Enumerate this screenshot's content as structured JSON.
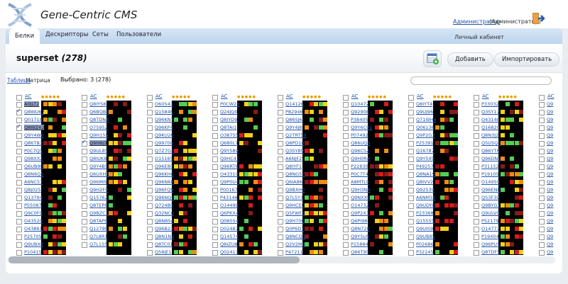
{
  "app": {
    "title": "Gene-Centric CMS",
    "user_link": "Администратор",
    "user_role": "(Администратор)"
  },
  "tabs": [
    "Белки",
    "Дескрипторы",
    "Сеты",
    "Пользователи"
  ],
  "cabinet_label": "Личный кабинет",
  "set": {
    "name": "superset",
    "count": "(278)"
  },
  "buttons": {
    "add": "Добавить",
    "import": "Импортировать"
  },
  "view": {
    "table_link": "Таблица",
    "current": "Матрица",
    "selected": "Выбрано: 3 (278)"
  },
  "grid_header": "AC",
  "colors": {
    "green": "#55cc55",
    "yellow": "#f2d21a",
    "orange": "#f08c10",
    "red": "#d81b1b",
    "darkred": "#8a1a1a",
    "highlight": "#8aa0c4"
  },
  "groups": [
    [
      "A0JLT2",
      "Q8WU67",
      "Q01718",
      "Q8WZ42",
      "Q9Y4W6",
      "Q86TB3",
      "P0C7Q5",
      "Q98XX2",
      "Q6UB98",
      "Q8N6Q5",
      "A6NC57",
      "Q8J025",
      "Q13794",
      "P55087",
      "Q9C0F0",
      "O43520",
      "O43861",
      "P25705",
      "Q9UBX8",
      "P10415"
    ],
    [
      "Q8IYS8",
      "Q6BQB6",
      "Q8TDN4",
      "O75952",
      "Q9H159",
      "Q9H8J3",
      "Q9UL85",
      "Q8IUK8",
      "Q9Y4B5",
      "Q6UXH8",
      "Q96MI9",
      "Q9H2F9",
      "Q15762",
      "Q8TEP8",
      "Q9BZC1",
      "Q8TAP6",
      "Q12798",
      "Q7L8R1",
      "Q7L155"
    ],
    [
      "O60543",
      "Q15846",
      "Q96KN7",
      "Q96KP4",
      "Q9KU26",
      "Q99708",
      "Q7Z7G3",
      "O15165",
      "Q96E80",
      "Q96KH6",
      "Q96N68",
      "Q96FQ9",
      "Q96NQ0",
      "Q72480",
      "Q32NC0",
      "Q8N8S4",
      "Q96B23",
      "Q8N1N2",
      "Q8TC01",
      "Q58JE1"
    ],
    [
      "P0CW23",
      "Q24JQ0",
      "Q8IYD9",
      "Q8TAI1",
      "O38755",
      "Q680L7",
      "Q9Y580",
      "Q9HC47",
      "Q96RT6",
      "O43310",
      "Q9P0U4",
      "P00167",
      "P43146",
      "O14490",
      "Q6PKX4",
      "Q08554",
      "O02487",
      "Q14574",
      "Q8IZU8",
      "Q02413"
    ],
    [
      "Q14126",
      "P82946",
      "Q86SJ6",
      "Q9Y4J8",
      "Q2TRT59",
      "Q8PD18",
      "Q3SY89",
      "A6NJF2",
      "Q8IYF1",
      "Q8NG57",
      "Q6IA86",
      "Q9BXH0",
      "Q7L5Y1",
      "Q9HCE0",
      "Q5FWF5",
      "Q9H706",
      "Q0P6D7",
      "Q8NCQ5",
      "Q2V2M9",
      "P47211"
    ],
    [
      "Q10472",
      "Q92908",
      "P38405",
      "Q9Y6C91",
      "P07492",
      "Q86UQ5",
      "Q96C52",
      "Q9H0R4",
      "P22830",
      "P0C7T4",
      "A8MTL9",
      "Q9H3N8",
      "Q9NXX9",
      "O14732",
      "Q9P2X3",
      "Q6PI98",
      "Q8N720",
      "Q9Y5U9",
      "P15884",
      "Q86T90",
      "Q9P260"
    ],
    [
      "Q8IYT4",
      "Q9UJ96",
      "Q71I9H9",
      "Q06136",
      "Q9P2G3",
      "P25391",
      "Q16787",
      "Q9Y5X9",
      "P49257",
      "Q8NA19",
      "Q8IVV2",
      "Q92539",
      "A6NM36",
      "Q9UDY8",
      "P23368",
      "Q15555",
      "Q9UIS9",
      "Q9UB85",
      "P02686",
      "P32245"
    ],
    [
      "P33032",
      "Q3SY17",
      "O43148",
      "Q16820",
      "Q8N3J2",
      "Q5U5Q3",
      "Q86YT6",
      "Q96DN6",
      "P31152",
      "P19105",
      "O14950",
      "Q96EN8",
      "Q53F39",
      "Q9BYG7",
      "Q9ULV0",
      "P52179",
      "O14777",
      "P19404",
      "Q96PU5",
      "Q8TDF5"
    ],
    [
      "Q9",
      "Q9",
      "Q9",
      "Q9",
      "Q9",
      "Q9",
      "Q9",
      "Q9",
      "Q9",
      "Q9",
      "Q9",
      "Q9",
      "Q9",
      "Q9",
      "Q9",
      "Q9",
      "Q9",
      "Q9",
      "Q9",
      "Q9"
    ]
  ],
  "checked": [
    [
      0,
      1
    ],
    [
      0,
      3
    ],
    [
      1,
      5
    ]
  ],
  "highlighted": [
    [
      0,
      0
    ],
    [
      0,
      3
    ],
    [
      1,
      5
    ]
  ]
}
